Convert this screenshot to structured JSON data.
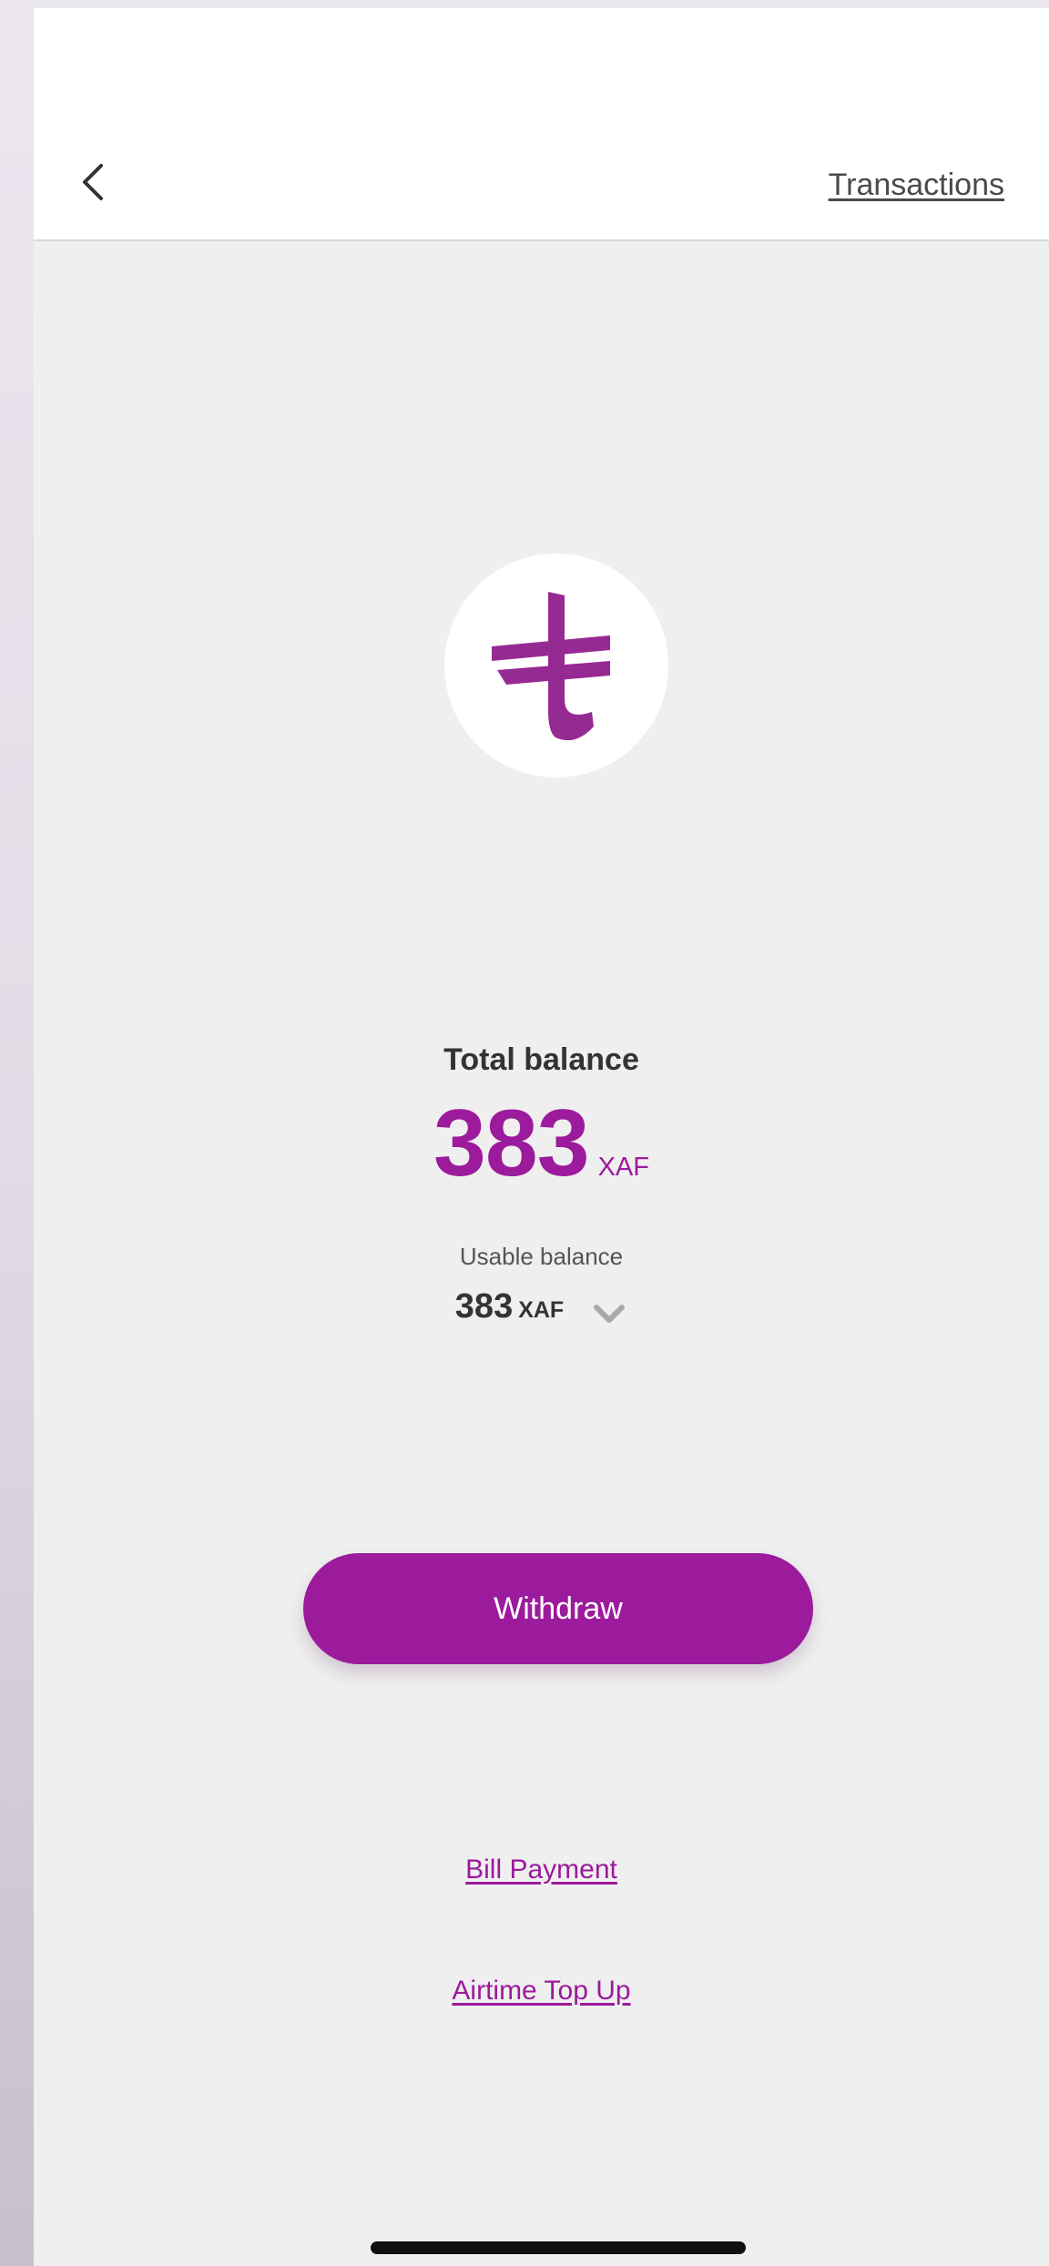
{
  "header": {
    "transactions_label": "Transactions"
  },
  "logo": {
    "symbol": "₮",
    "brand_color": "#9c1a9c"
  },
  "balance": {
    "total_label": "Total balance",
    "total_amount": "383",
    "total_currency": "XAF",
    "usable_label": "Usable balance",
    "usable_amount": "383",
    "usable_currency": "XAF"
  },
  "actions": {
    "withdraw_label": "Withdraw",
    "bill_payment_label": "Bill Payment",
    "airtime_top_up_label": "Airtime Top Up"
  },
  "icons": {
    "back": "chevron-left-icon",
    "expand": "chevron-down-icon"
  },
  "colors": {
    "accent": "#9c1a9c",
    "background": "#efefef",
    "header_background": "#ffffff",
    "text": "#333333"
  }
}
